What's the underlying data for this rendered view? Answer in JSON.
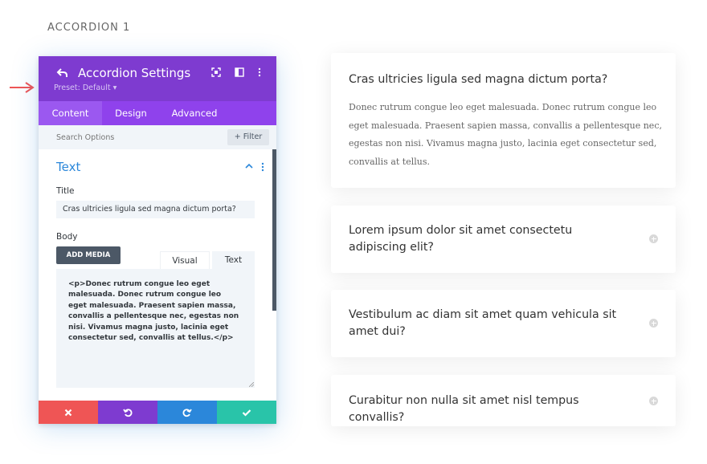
{
  "section_label": "ACCORDION 1",
  "panel": {
    "title": "Accordion Settings",
    "preset": "Preset: Default ▾",
    "tabs": [
      {
        "label": "Content",
        "active": true
      },
      {
        "label": "Design",
        "active": false
      },
      {
        "label": "Advanced",
        "active": false
      }
    ],
    "search_placeholder": "Search Options",
    "filter_label": "+ Filter",
    "group_title": "Text",
    "title_label": "Title",
    "title_value": "Cras ultricies ligula sed magna dictum porta?",
    "body_label": "Body",
    "add_media_label": "ADD MEDIA",
    "editor_tabs": [
      "Visual",
      "Text"
    ],
    "body_value": "<p>Donec rutrum congue leo eget malesuada. Donec rutrum congue leo eget malesuada. Praesent sapien massa, convallis a pellentesque nec, egestas non nisi. Vivamus magna justo, lacinia eget consectetur sed, convallis at tellus.</p>",
    "footer_colors": {
      "cancel": "#ef5555",
      "undo": "#7e3bd0",
      "redo": "#2b87da",
      "save": "#29c4a9"
    },
    "colors": {
      "header": "#7e3bd0",
      "tabs": "#8f42ec",
      "accent": "#2b87da"
    }
  },
  "accordion": [
    {
      "title": "Cras ultricies ligula sed magna dictum porta?",
      "body": "Donec rutrum congue leo eget malesuada. Donec rutrum congue leo eget malesuada. Praesent sapien massa, convallis a pellentesque nec, egestas non nisi. Vivamus magna justo, lacinia eget consectetur sed, convallis at tellus.",
      "open": true
    },
    {
      "title": "Lorem ipsum dolor sit amet consectetu adipiscing elit?",
      "open": false
    },
    {
      "title": "Vestibulum ac diam sit amet quam vehicula sit amet dui?",
      "open": false
    },
    {
      "title": "Curabitur non nulla sit amet nisl tempus convallis?",
      "open": false
    }
  ]
}
